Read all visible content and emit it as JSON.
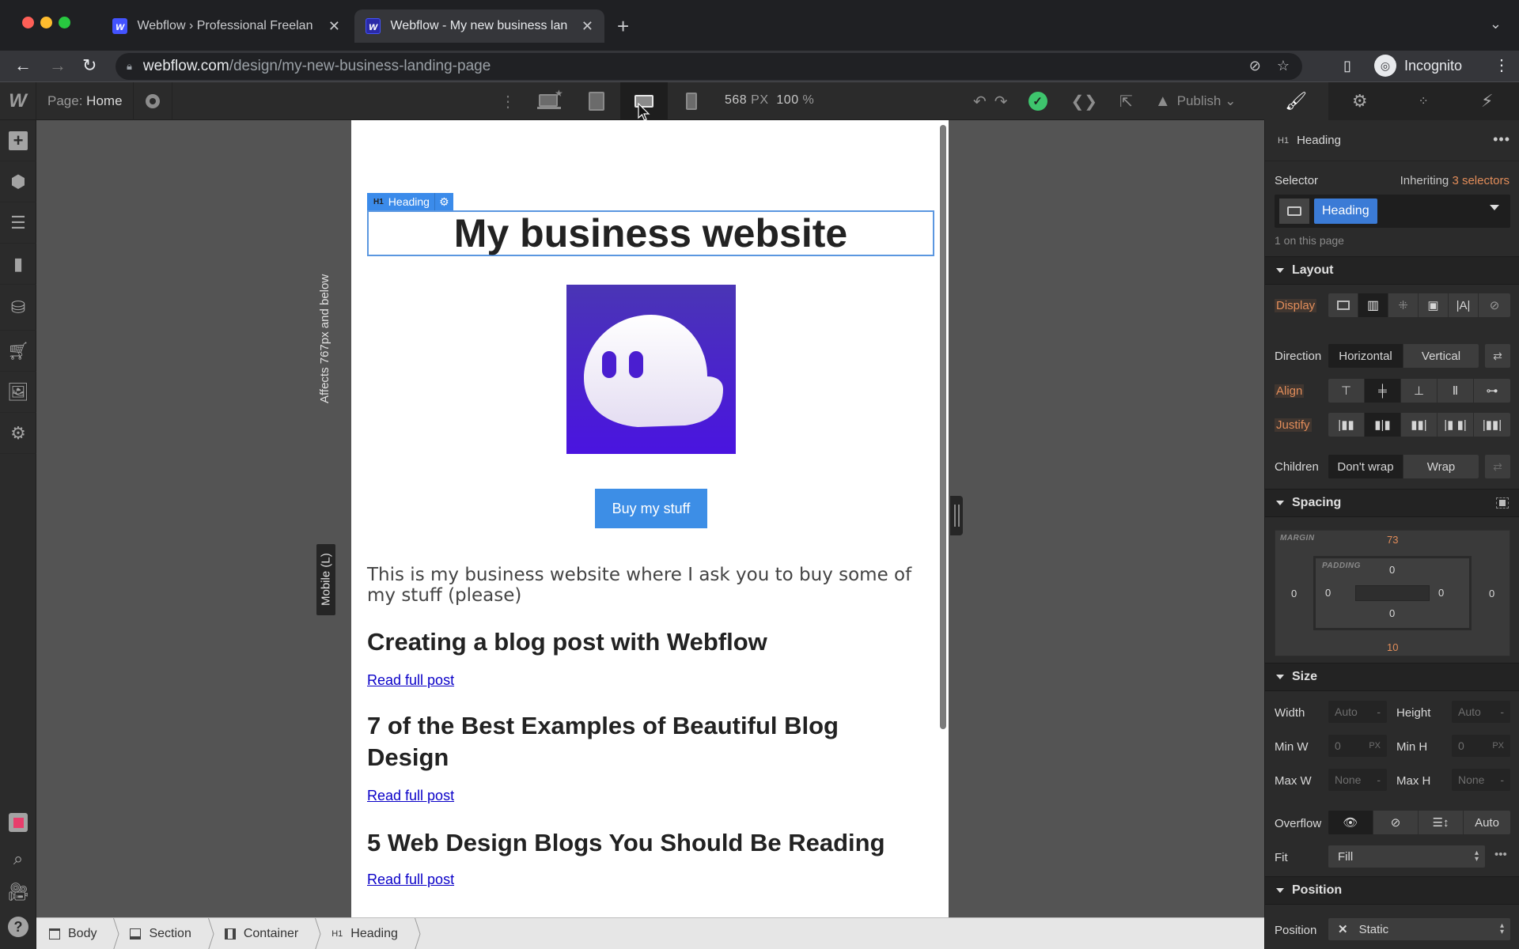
{
  "browser": {
    "tabs": [
      {
        "title": "Webflow › Professional Freelan",
        "favicon": "webflow-logo",
        "active": false
      },
      {
        "title": "Webflow - My new business lan",
        "favicon": "webflow-logo",
        "active": true
      }
    ],
    "new_tab_icon": "+",
    "tab_menu_icon": "⌄",
    "url_host": "webflow.com",
    "url_path": "/design/my-new-business-landing-page",
    "profile_label": "Incognito"
  },
  "topbar": {
    "logo": "W",
    "page_prefix": "Page:",
    "page_name": "Home",
    "width_value": "568",
    "width_unit": "PX",
    "zoom_value": "100",
    "zoom_unit": "%",
    "publish_label": "Publish",
    "active_device": "mobile-landscape",
    "right_tabs": [
      "style",
      "settings",
      "interactions-drops",
      "interactions"
    ]
  },
  "breakpoint": {
    "name": "Mobile (L)",
    "note": "Affects 767px and below"
  },
  "canvas": {
    "selected_label_tag": "H1",
    "selected_label": "Heading",
    "heading": "My business website",
    "button_label": "Buy my stuff",
    "intro": "This is my business website where I ask you to buy some of my stuff (please)",
    "posts": [
      {
        "title": "Creating a blog post with Webflow",
        "link": "Read full post"
      },
      {
        "title": "7 of the Best Examples of Beautiful Blog Design",
        "link": "Read full post"
      },
      {
        "title": "5 Web Design Blogs You Should Be Reading",
        "link": "Read full post"
      }
    ]
  },
  "breadcrumbs": [
    {
      "label": "Body",
      "icon": "body-icon"
    },
    {
      "label": "Section",
      "icon": "section-icon"
    },
    {
      "label": "Container",
      "icon": "container-icon"
    },
    {
      "label": "Heading",
      "icon": "h1-icon",
      "tag": "H1"
    }
  ],
  "panel": {
    "element_tag": "H1",
    "element_name": "Heading",
    "selector_label": "Selector",
    "inheriting_prefix": "Inheriting",
    "inheriting_count": "3 selectors",
    "selector_chip": "Heading",
    "on_page": "1 on this page",
    "layout": {
      "title": "Layout",
      "display_label": "Display",
      "direction_label": "Direction",
      "direction_options": [
        "Horizontal",
        "Vertical"
      ],
      "direction_selected": "Horizontal",
      "align_label": "Align",
      "justify_label": "Justify",
      "children_label": "Children",
      "children_options": [
        "Don't wrap",
        "Wrap"
      ],
      "children_selected": "Don't wrap"
    },
    "spacing": {
      "title": "Spacing",
      "margin_label": "MARGIN",
      "padding_label": "PADDING",
      "margin": {
        "top": "73",
        "right": "0",
        "bottom": "10",
        "left": "0"
      },
      "padding": {
        "top": "0",
        "right": "0",
        "bottom": "0",
        "left": "0"
      }
    },
    "size": {
      "title": "Size",
      "width_label": "Width",
      "width_value": "Auto",
      "height_label": "Height",
      "height_value": "Auto",
      "minw_label": "Min W",
      "minw_value": "0",
      "minw_unit": "PX",
      "minh_label": "Min H",
      "minh_value": "0",
      "minh_unit": "PX",
      "maxw_label": "Max W",
      "maxw_value": "None",
      "maxh_label": "Max H",
      "maxh_value": "None",
      "overflow_label": "Overflow",
      "overflow_auto": "Auto",
      "fit_label": "Fit",
      "fit_value": "Fill"
    },
    "position": {
      "title": "Position",
      "label": "Position",
      "value": "Static"
    }
  },
  "colors": {
    "accent_blue": "#3b8bea",
    "publish_check": "#3ec46d",
    "orange_override": "#e28d5a",
    "link": "#0a00c8",
    "logo_purple": "#4a1ee0"
  }
}
